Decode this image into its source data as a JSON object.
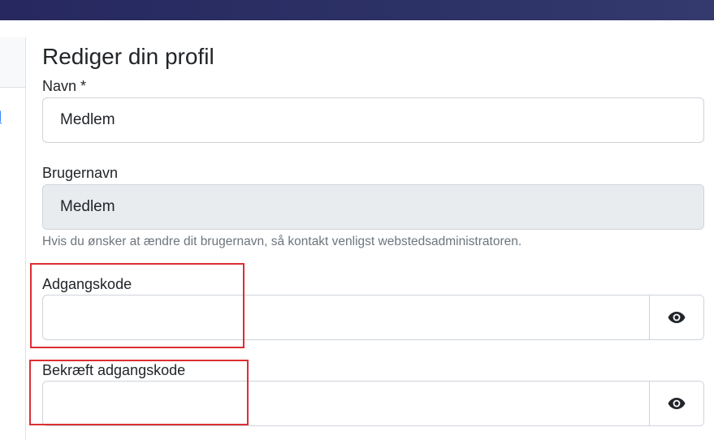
{
  "sidebar": {
    "link_label": "d"
  },
  "page": {
    "title": "Rediger din profil"
  },
  "form": {
    "name": {
      "label": "Navn *",
      "value": "Medlem"
    },
    "username": {
      "label": "Brugernavn",
      "value": "Medlem",
      "help": "Hvis du ønsker at ændre dit brugernavn, så kontakt venligst webstedsadministratoren."
    },
    "password": {
      "label": "Adgangskode",
      "value": "",
      "toggle_icon": "eye-icon"
    },
    "confirm_password": {
      "label": "Bekræft adgangskode",
      "value": "",
      "toggle_icon": "eye-icon"
    }
  },
  "colors": {
    "header": "#2b2f64",
    "highlight": "#dc2f34",
    "readonly_bg": "#e9ecef",
    "help_text": "#6c757d"
  }
}
